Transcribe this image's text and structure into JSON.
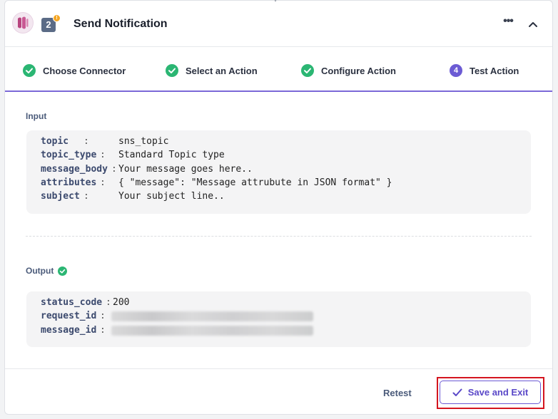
{
  "header": {
    "step_number": "2",
    "warning_badge": "!",
    "title": "Send Notification",
    "more_icon": "more-horizontal-icon",
    "collapse_icon": "chevron-up-icon"
  },
  "steps": [
    {
      "label": "Choose Connector",
      "status": "complete"
    },
    {
      "label": "Select an Action",
      "status": "complete"
    },
    {
      "label": "Configure Action",
      "status": "complete"
    },
    {
      "label": "Test Action",
      "status": "active",
      "number": "4"
    }
  ],
  "input": {
    "label": "Input",
    "rows": [
      {
        "key": "topic",
        "value": "sns_topic"
      },
      {
        "key": "topic_type",
        "value": "Standard Topic type"
      },
      {
        "key": "message_body",
        "value": "Your message goes here.."
      },
      {
        "key": "attributes",
        "value": "{ \"message\": \"Message attrubute in JSON format\" }"
      },
      {
        "key": "subject",
        "value": "Your subject line.."
      }
    ]
  },
  "output": {
    "label": "Output",
    "rows": [
      {
        "key": "status_code",
        "value": "200"
      },
      {
        "key": "request_id",
        "value": ""
      },
      {
        "key": "message_id",
        "value": ""
      }
    ]
  },
  "footer": {
    "retest_label": "Retest",
    "save_label": "Save and Exit"
  },
  "colors": {
    "accent": "#6c5bd4",
    "success": "#2bb673",
    "highlight": "#d4151f"
  }
}
